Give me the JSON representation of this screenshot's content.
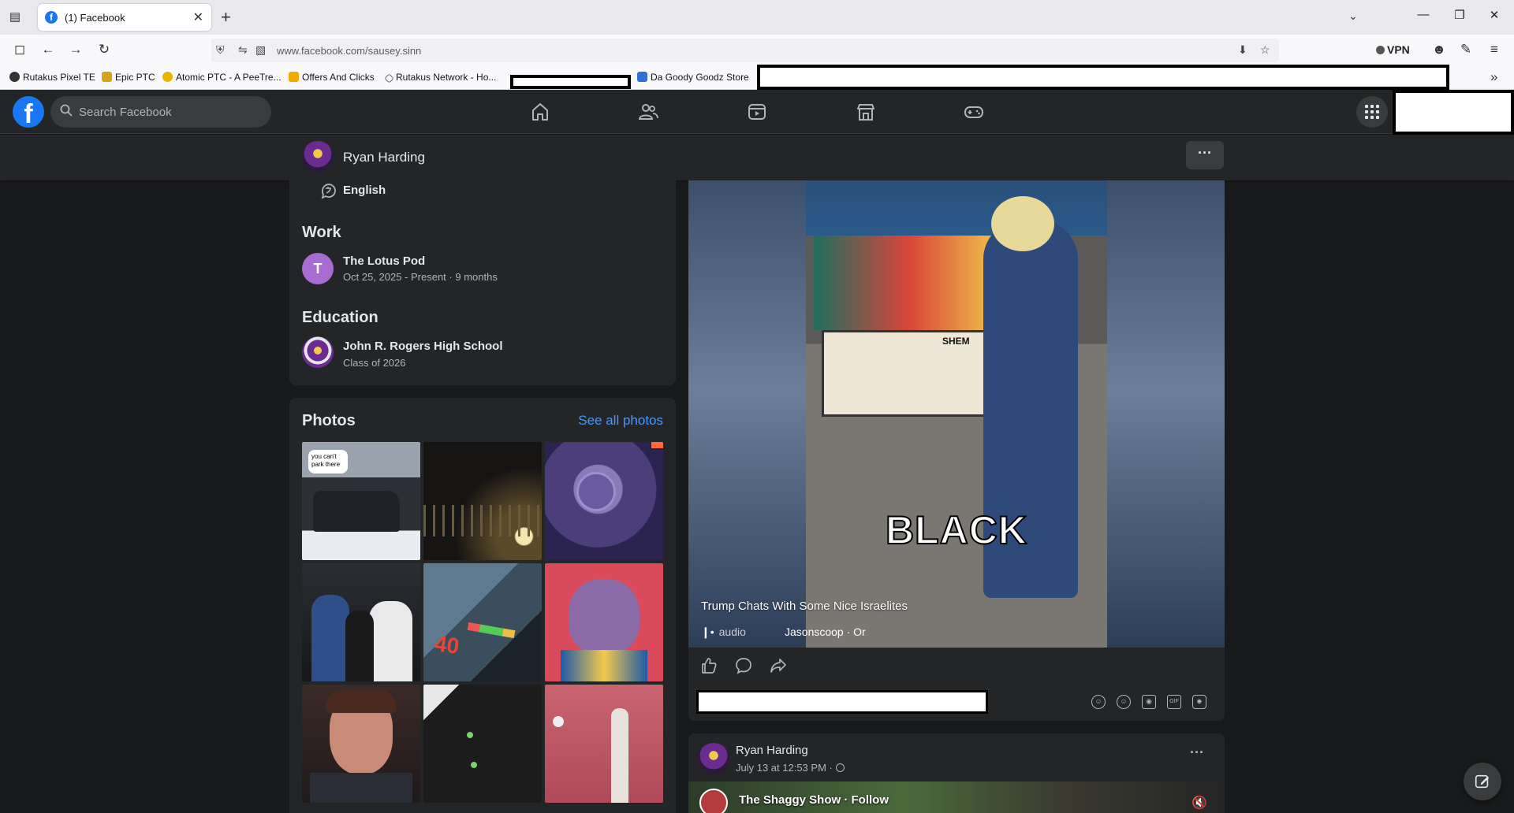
{
  "browser": {
    "tab_title": "(1) Facebook",
    "url": "www.facebook.com/sausey.sinn",
    "vpn_label": "VPN",
    "bookmarks": [
      {
        "label": "Rutakus Pixel TE",
        "color": "#333333"
      },
      {
        "label": "Epic PTC",
        "color": "#d9a21b"
      },
      {
        "label": "Atomic PTC - A PeeTre...",
        "color": "#e8b400"
      },
      {
        "label": "Offers And Clicks",
        "color": "#f2a900"
      },
      {
        "label": "Rutakus Network - Ho...",
        "color": "#6b6b6b"
      },
      {
        "label": "Da Goody Goodz Store",
        "color": "#2f6fd6"
      }
    ]
  },
  "fb": {
    "search_placeholder": "Search Facebook",
    "nav_icons": [
      "home-icon",
      "friends-icon",
      "video-icon",
      "marketplace-icon",
      "gaming-icon"
    ]
  },
  "profile": {
    "name": "Ryan Harding",
    "language": "English"
  },
  "intro": {
    "work_heading": "Work",
    "work": {
      "initial": "T",
      "title": "The Lotus Pod",
      "subtitle": "Oct 25, 2025 - Present · 9 months",
      "color": "#a86bd1"
    },
    "education_heading": "Education",
    "education": {
      "title": "John R. Rogers High School",
      "subtitle": "Class of 2026"
    }
  },
  "photos": {
    "heading": "Photos",
    "see_all": "See all photos",
    "overlay_text": [
      "you can't",
      "park there"
    ],
    "number_overlay": "40",
    "items": [
      "suv-in-snow-photo",
      "night-fence-photo",
      "plush-toys-photo",
      "friends-group-photo",
      "game-screen-photo",
      "cartoon-cat-god-photo",
      "man-portrait-photo",
      "black-cat-photo",
      "pink-room-photo"
    ]
  },
  "reel": {
    "overlay_word": "BLACK",
    "caption": "Trump Chats With Some Nice Israelites",
    "audio": "audio",
    "creator": "Jasonscoop · Or",
    "stall_sign": "SHEM",
    "comment_icons": [
      "avatar-sticker-icon",
      "emoji-icon",
      "camera-icon",
      "gif-icon",
      "sticker-icon"
    ]
  },
  "post2": {
    "author": "Ryan Harding",
    "time": "July 13 at 12:53 PM ·",
    "shared_page": "The Shaggy Show · Follow"
  },
  "colors": {
    "fb_blue": "#1877f2",
    "link": "#4599ff",
    "surface": "#242526",
    "background": "#18191a"
  }
}
